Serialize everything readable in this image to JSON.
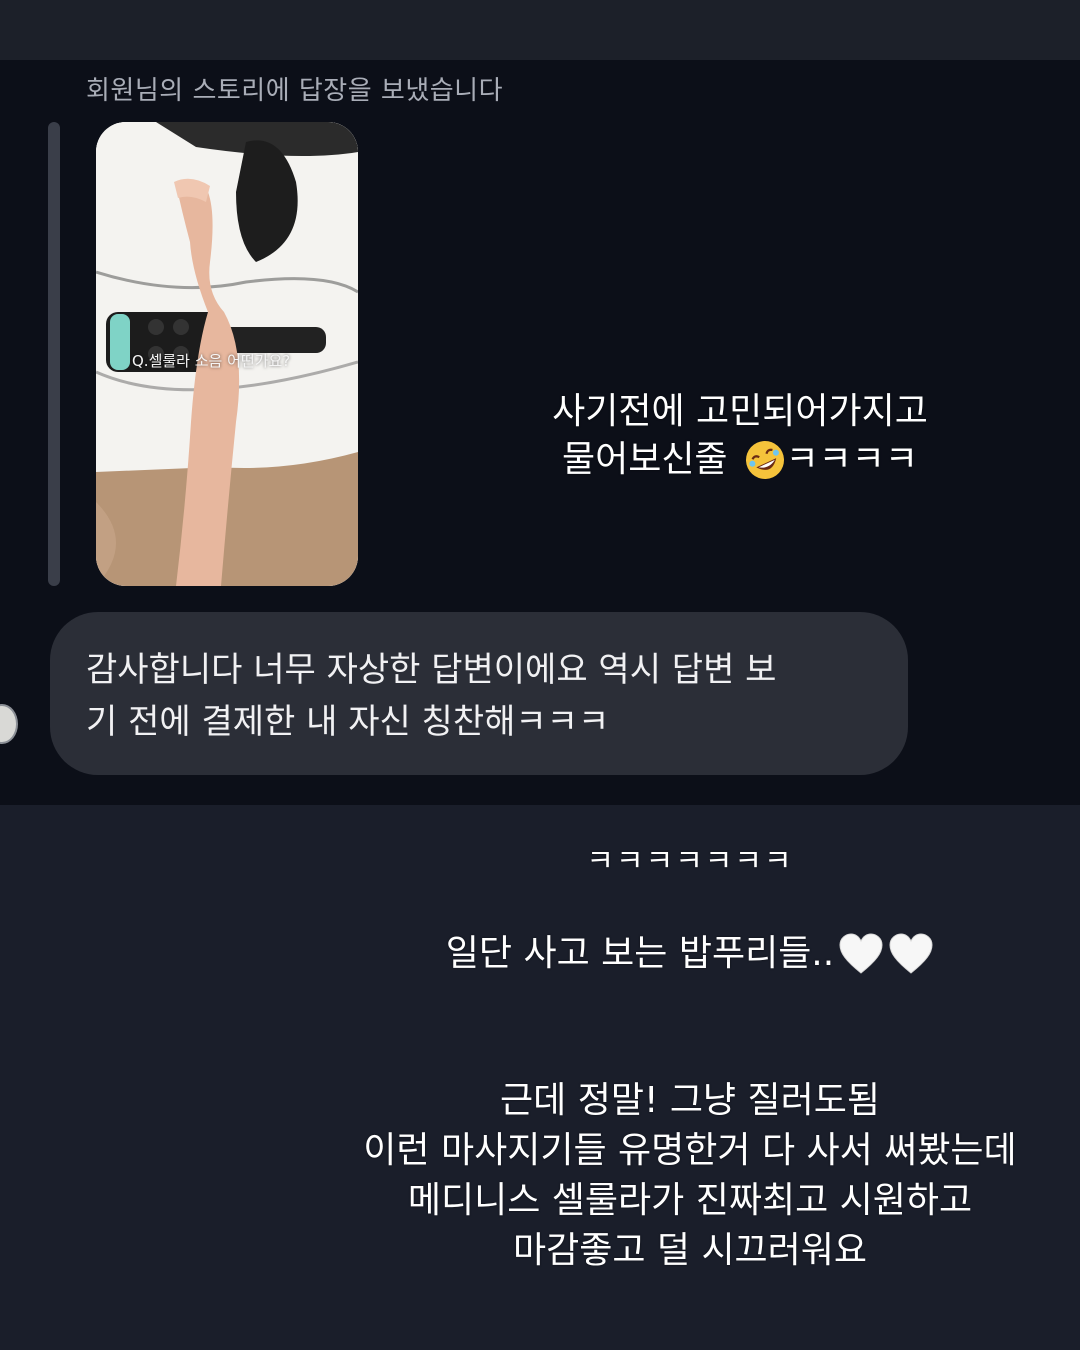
{
  "reply_header": "회원님의 스토리에 답장을 보냈습니다",
  "story": {
    "caption": "Q.셀룰라 소음 어떤가요?"
  },
  "message": {
    "line1": "감사합니다 너무 자상한 답변이에요 역시 답변 보",
    "line2": "기 전에 결제한 내 자신 칭찬해ㅋㅋㅋ"
  },
  "overlay1": {
    "line1": "사기전에 고민되어가지고",
    "line2_text": "물어보신줄",
    "line2_laugh": "ㅋㅋㅋㅋ",
    "emoji": "rolling-on-floor-laughing-emoji"
  },
  "overlay2": "ㅋㅋㅋㅋㅋㅋㅋ",
  "overlay3": {
    "text": "일단 사고 보는 밥푸리들..",
    "hearts": [
      "white-heart-icon",
      "white-heart-icon"
    ]
  },
  "overlay4": {
    "line1": "근데 정말! 그냥 질러도됨",
    "line2": "이런 마사지기들 유명한거 다 사서 써봤는데",
    "line3": "메디니스 셀룰라가 진짜최고 시원하고",
    "line4": "마감좋고 덜 시끄러워요"
  },
  "colors": {
    "page_bg": "#1a1e2a",
    "chat_bg": "#0c0f18",
    "bubble_bg": "#2b2e37",
    "header_text": "#a9adb7"
  }
}
